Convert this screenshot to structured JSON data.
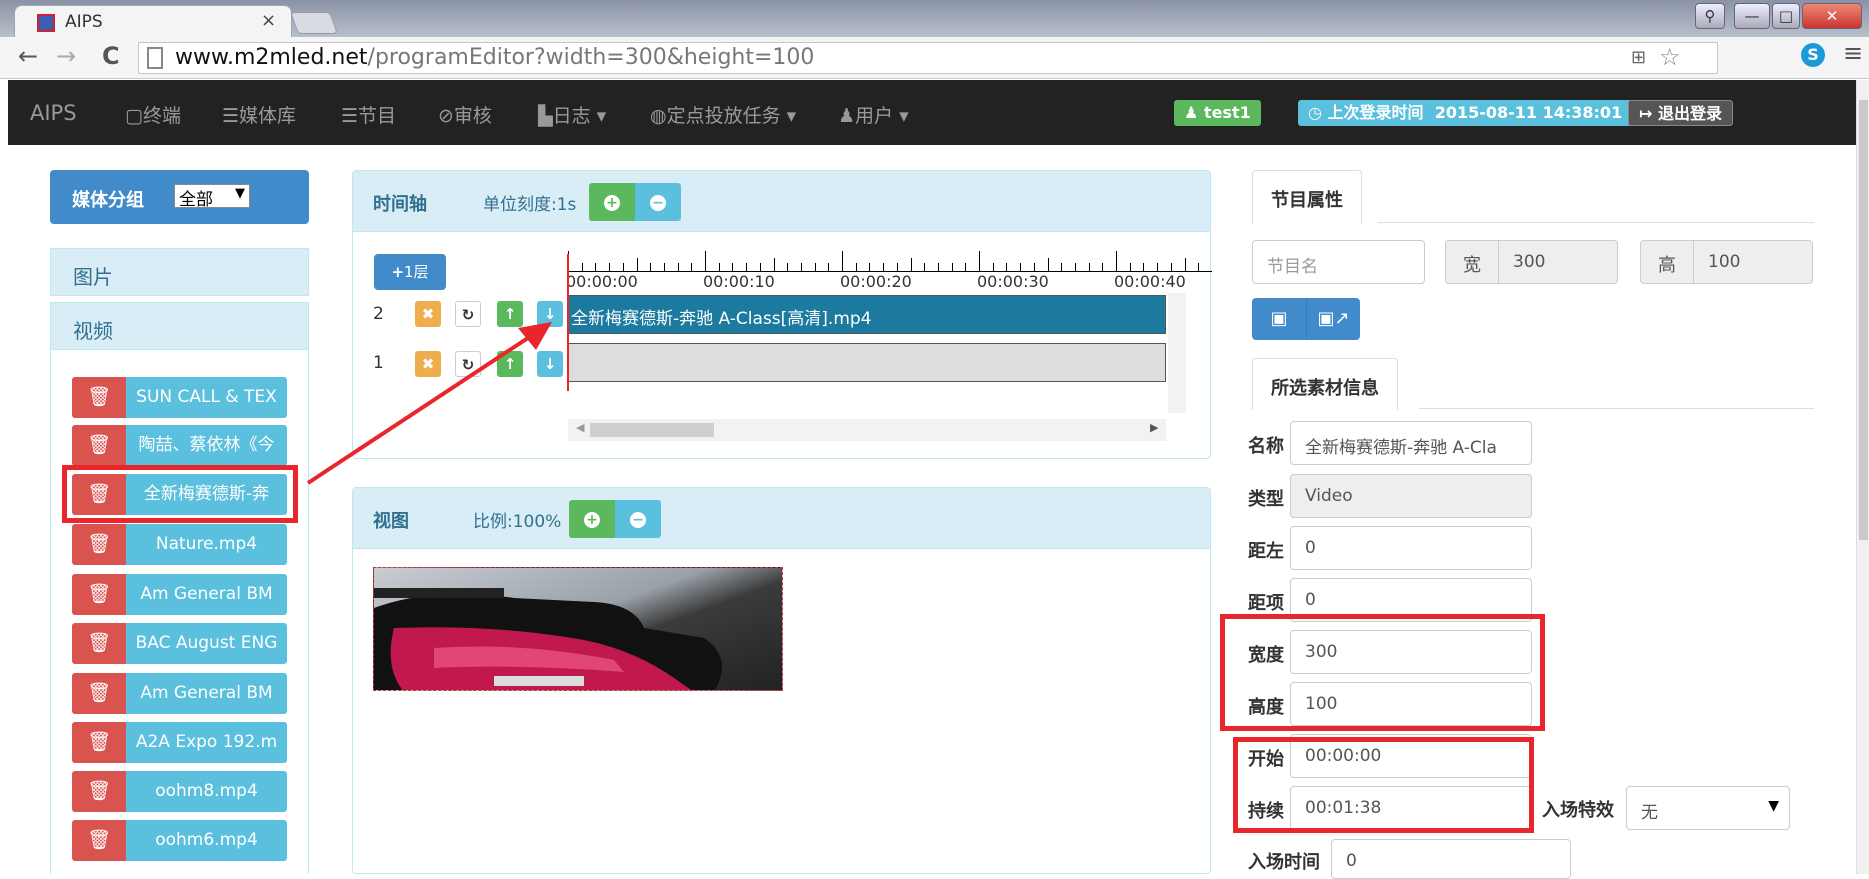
{
  "browser": {
    "tab_title": "AIPS",
    "tab_close": "×",
    "url_host": "www.m2mled.net",
    "url_path": "/programEditor?width=300&height=100",
    "back": "←",
    "forward": "→",
    "reload": "C"
  },
  "navbar": {
    "brand": "AIPS",
    "items": [
      "终端",
      "媒体库",
      "节目",
      "审核",
      "日志",
      "定点投放任务",
      "用户"
    ],
    "user_label": "test1",
    "last_login_label": "上次登录时间",
    "last_login_time": "2015-08-11 14:38:01",
    "logout_label": "退出登录"
  },
  "sidebar": {
    "group_label": "媒体分组",
    "group_select": "全部",
    "categories": [
      "图片",
      "视频"
    ],
    "media": [
      "SUN CALL & TEX",
      "陶喆、蔡依林《今",
      "全新梅赛德斯-奔",
      "Nature.mp4",
      "Am General BM",
      "BAC August ENG",
      "Am General BM",
      "A2A Expo 192.m",
      "oohm8.mp4",
      "oohm6.mp4"
    ]
  },
  "timeline": {
    "title": "时间轴",
    "unit_label": "单位刻度:1s",
    "add_layer": "1层",
    "rows": [
      {
        "num": "2",
        "clip": "全新梅赛德斯-奔驰 A-Class[高清].mp4"
      },
      {
        "num": "1",
        "clip": ""
      }
    ],
    "ticks": [
      "00:00:00",
      "00:00:10",
      "00:00:20",
      "00:00:30",
      "00:00:40"
    ]
  },
  "view": {
    "title": "视图",
    "scale_label": "比例:100%"
  },
  "program": {
    "tab": "节目属性",
    "name_placeholder": "节目名",
    "width_label": "宽",
    "width_value": "300",
    "height_label": "高",
    "height_value": "100"
  },
  "material": {
    "tab": "所选素材信息",
    "fields": {
      "name_label": "名称",
      "name_value": "全新梅赛德斯-奔驰 A-Cla",
      "type_label": "类型",
      "type_value": "Video",
      "left_label": "距左",
      "left_value": "0",
      "top_label": "距项",
      "top_value": "0",
      "width_label": "宽度",
      "width_value": "300",
      "height_label": "高度",
      "height_value": "100",
      "start_label": "开始",
      "start_value": "00:00:00",
      "duration_label": "持续",
      "duration_value": "00:01:38",
      "effect_label": "入场特效",
      "effect_value": "无",
      "entry_time_label": "入场时间",
      "entry_time_value": "0"
    }
  },
  "colors": {
    "primary": "#428bca",
    "info": "#5bc0de",
    "success": "#5cb85c",
    "danger": "#d9534f",
    "warning": "#f0ad4e",
    "highlight_red": "#e8262b",
    "timeline_clip": "#1b7a9e"
  }
}
